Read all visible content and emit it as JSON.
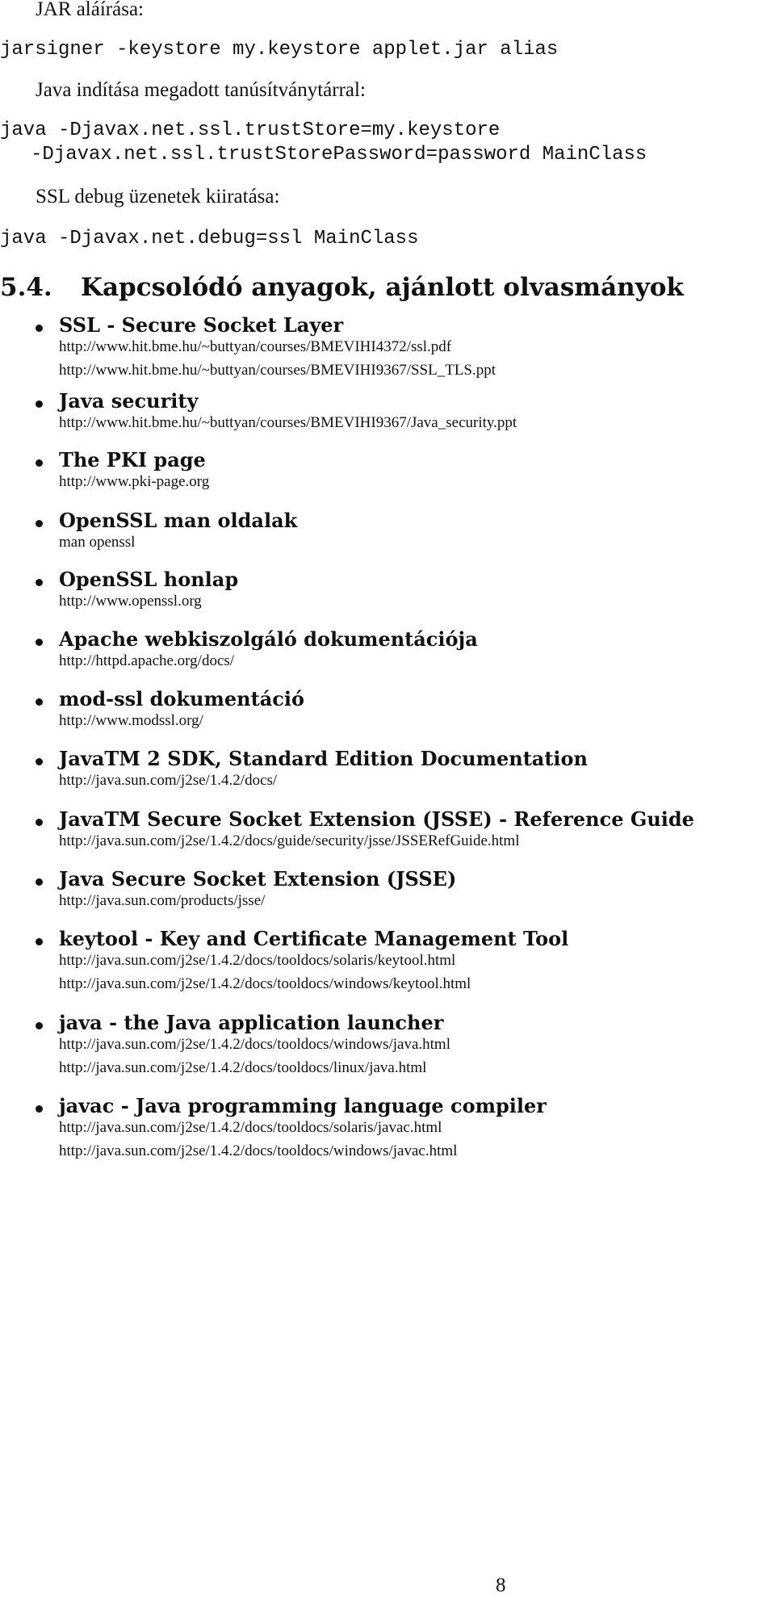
{
  "page": {
    "paragraphs": {
      "jar_signing": "JAR aláírása:",
      "java_truststore": "Java indítása megadott tanúsítványtárral:",
      "ssl_debug": "SSL debug üzenetek kiiratása:"
    },
    "code": {
      "jarsigner": "jarsigner -keystore my.keystore applet.jar alias",
      "java_truststore_line1": "java -Djavax.net.ssl.trustStore=my.keystore",
      "java_truststore_line2": "-Djavax.net.ssl.trustStorePassword=password MainClass",
      "java_debug": "java -Djavax.net.debug=ssl MainClass"
    },
    "section": {
      "number": "5.4.",
      "title": "Kapcsolódó anyagok, ajánlott olvasmányok"
    },
    "items": [
      {
        "title": "SSL - Secure Socket Layer",
        "links": [
          "http://www.hit.bme.hu/~buttyan/courses/BMEVIHI4372/ssl.pdf",
          "http://www.hit.bme.hu/~buttyan/courses/BMEVIHI9367/SSL_TLS.ppt"
        ]
      },
      {
        "title": "Java security",
        "links": [
          "http://www.hit.bme.hu/~buttyan/courses/BMEVIHI9367/Java_security.ppt"
        ]
      },
      {
        "title": "The PKI page",
        "links": [
          "http://www.pki-page.org"
        ]
      },
      {
        "title": "OpenSSL man oldalak",
        "links": [
          "man openssl"
        ]
      },
      {
        "title": "OpenSSL honlap",
        "links": [
          "http://www.openssl.org"
        ]
      },
      {
        "title": "Apache webkiszolgáló dokumentációja",
        "links": [
          "http://httpd.apache.org/docs/"
        ]
      },
      {
        "title": "mod-ssl dokumentáció",
        "links": [
          "http://www.modssl.org/"
        ]
      },
      {
        "title": "JavaTM 2 SDK, Standard Edition Documentation",
        "links": [
          "http://java.sun.com/j2se/1.4.2/docs/"
        ]
      },
      {
        "title": "JavaTM Secure Socket Extension (JSSE) - Reference Guide",
        "links": [
          "http://java.sun.com/j2se/1.4.2/docs/guide/security/jsse/JSSERefGuide.html"
        ]
      },
      {
        "title": "Java Secure Socket Extension (JSSE)",
        "links": [
          "http://java.sun.com/products/jsse/"
        ]
      },
      {
        "title": "keytool - Key and Certificate Management Tool",
        "links": [
          "http://java.sun.com/j2se/1.4.2/docs/tooldocs/solaris/keytool.html",
          "http://java.sun.com/j2se/1.4.2/docs/tooldocs/windows/keytool.html"
        ]
      },
      {
        "title": "java - the Java application launcher",
        "links": [
          "http://java.sun.com/j2se/1.4.2/docs/tooldocs/windows/java.html",
          "http://java.sun.com/j2se/1.4.2/docs/tooldocs/linux/java.html"
        ]
      },
      {
        "title": "javac - Java programming language compiler",
        "links": [
          "http://java.sun.com/j2se/1.4.2/docs/tooldocs/solaris/javac.html",
          "http://java.sun.com/j2se/1.4.2/docs/tooldocs/windows/javac.html"
        ]
      }
    ],
    "page_number": "8"
  }
}
